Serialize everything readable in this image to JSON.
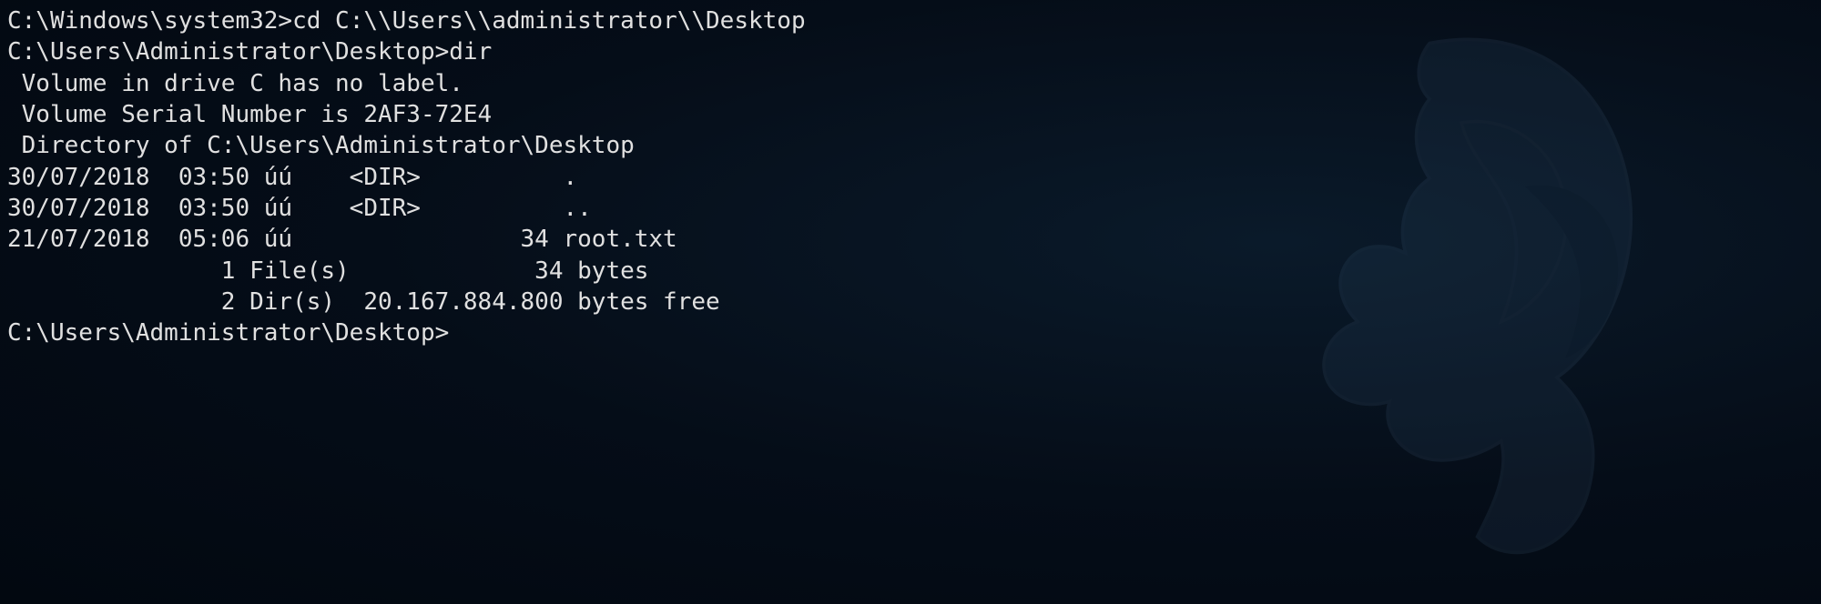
{
  "terminal": {
    "line1_prompt": "C:\\Windows\\system32>",
    "line1_command": "cd C:\\\\Users\\\\administrator\\\\Desktop",
    "blank1": "",
    "line2_prompt": "C:\\Users\\Administrator\\Desktop>",
    "line2_command": "dir",
    "line3": " Volume in drive C has no label.",
    "line4": " Volume Serial Number is 2AF3-72E4",
    "blank2": "",
    "line5": " Directory of C:\\Users\\Administrator\\Desktop",
    "blank3": "",
    "line6": "30/07/2018  03:50 úú    <DIR>          .",
    "line7": "30/07/2018  03:50 úú    <DIR>          ..",
    "line8": "21/07/2018  05:06 úú                34 root.txt",
    "line9": "               1 File(s)             34 bytes",
    "line10": "               2 Dir(s)  20.167.884.800 bytes free",
    "blank4": "",
    "line11_prompt": "C:\\Users\\Administrator\\Desktop>"
  }
}
